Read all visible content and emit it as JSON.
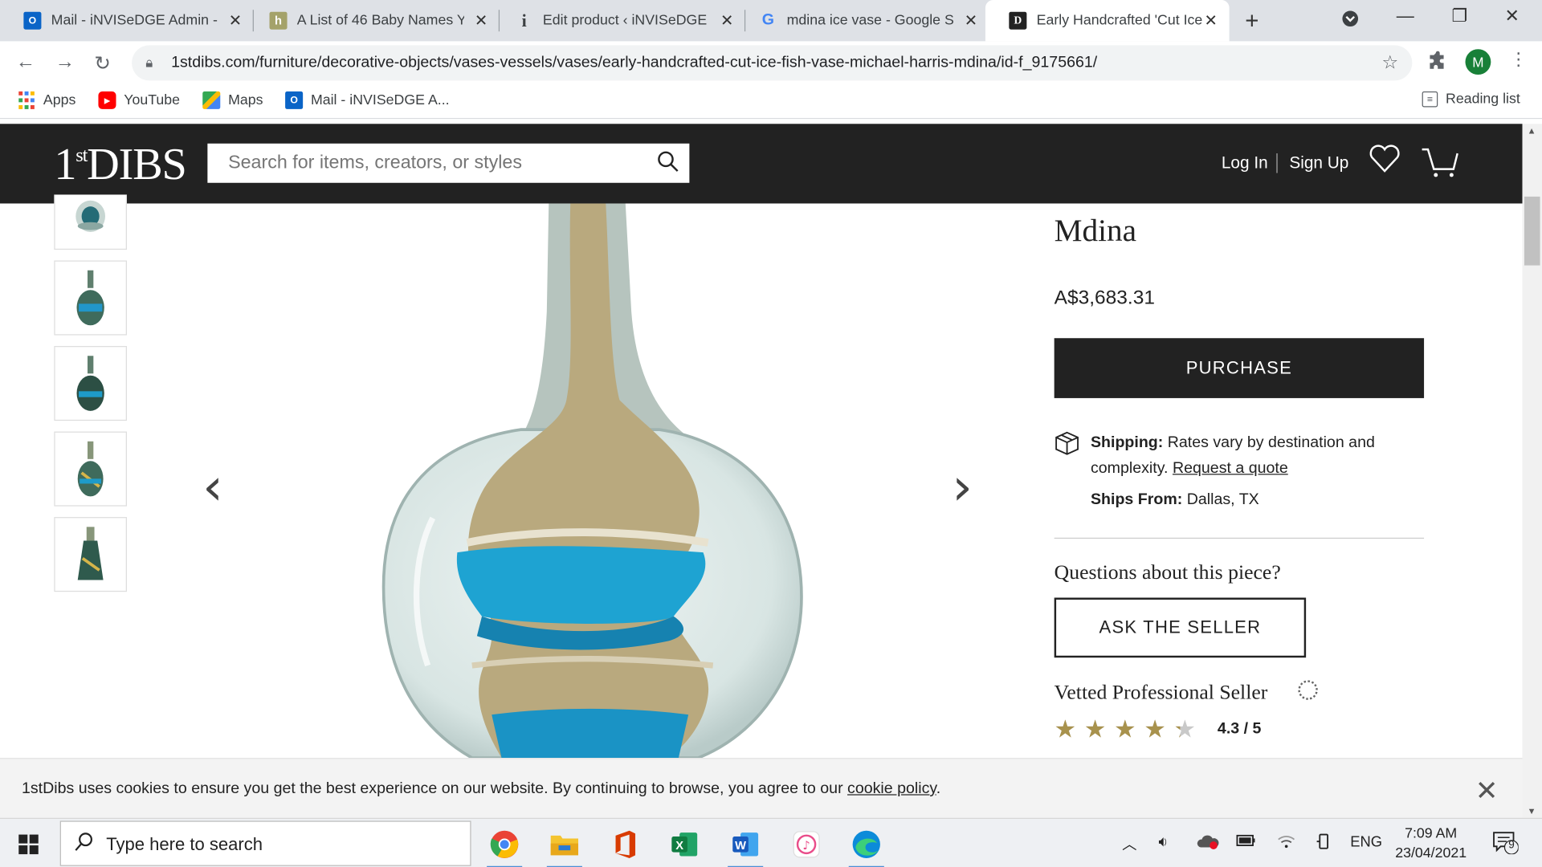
{
  "browser": {
    "tabs": [
      {
        "title": "Mail - iNVISeDGE Admin -",
        "icon": "outlook-icon"
      },
      {
        "title": "A List of 46 Baby Names Y",
        "icon": "h-icon"
      },
      {
        "title": "Edit product ‹ iNVISeDGE",
        "icon": "info-icon"
      },
      {
        "title": "mdina ice vase - Google S",
        "icon": "google-icon"
      },
      {
        "title": "Early Handcrafted 'Cut Ice",
        "icon": "1stdibs-icon",
        "active": true
      }
    ],
    "url": "1stdibs.com/furniture/decorative-objects/vases-vessels/vases/early-handcrafted-cut-ice-fish-vase-michael-harris-mdina/id-f_9175661/",
    "profile_initial": "M",
    "bookmarks": {
      "apps": "Apps",
      "youtube": "YouTube",
      "maps": "Maps",
      "mail": "Mail - iNVISeDGE A...",
      "reading_list": "Reading list"
    }
  },
  "site": {
    "logo": "1stDIBS",
    "search_placeholder": "Search for items, creators, or styles",
    "login": "Log In",
    "signup": "Sign Up"
  },
  "product": {
    "maker": "Mdina",
    "price": "A$3,683.31",
    "purchase_label": "PURCHASE",
    "shipping_label": "Shipping:",
    "shipping_text": "Rates vary by destination and complexity.",
    "request_quote": "Request a quote",
    "ships_from_label": "Ships From:",
    "ships_from": "Dallas, TX",
    "questions_heading": "Questions about this piece?",
    "ask_seller": "ASK THE SELLER",
    "vetted_seller": "Vetted Professional Seller",
    "rating_text": "4.3 / 5",
    "rating_value": 4.3,
    "rating_max": 5
  },
  "colors": {
    "site_header": "#222222",
    "star_gold": "#a8924d",
    "vase_blue": "#1ea3d2",
    "vase_sand": "#b9a97e"
  },
  "cookie": {
    "text": "1stDibs uses cookies to ensure you get the best experience on our website. By continuing to browse, you agree to our",
    "link": "cookie policy",
    "suffix": "."
  },
  "taskbar": {
    "search_placeholder": "Type here to search",
    "language": "ENG",
    "time": "7:09 AM",
    "date": "23/04/2021",
    "notification_count": "9"
  }
}
